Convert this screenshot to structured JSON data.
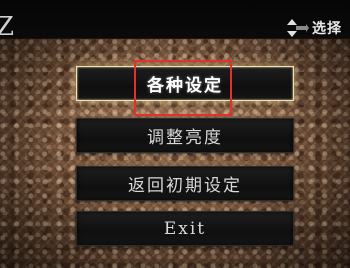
{
  "header": {
    "corner_glyph": "Z",
    "hint": {
      "icon": "dpad-up-down-icon",
      "label": "选择"
    }
  },
  "menu": {
    "items": [
      {
        "label": "各种设定",
        "selected": true
      },
      {
        "label": "调整亮度",
        "selected": false
      },
      {
        "label": "返回初期设定",
        "selected": false
      },
      {
        "label": "Exit",
        "selected": false
      }
    ]
  },
  "colors": {
    "highlight_frame": "#e0322e",
    "selected_border": "#f1e3b0",
    "button_bg": "#111111",
    "text": "#d9d9d9"
  }
}
